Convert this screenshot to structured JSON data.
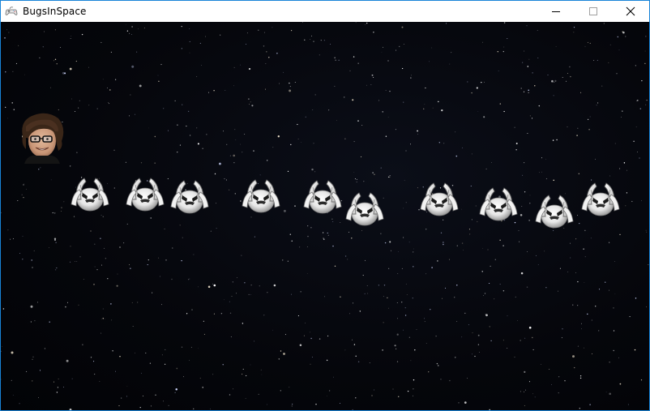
{
  "window": {
    "title": "BugsInSpace",
    "app_icon": "gamepad-icon",
    "controls": [
      "minimize-icon",
      "maximize-icon",
      "close-icon"
    ]
  },
  "game": {
    "background": "starfield",
    "player": {
      "sprite": "player-face-avatar"
    },
    "enemies": {
      "sprite": "bug-icon",
      "count": 10
    }
  }
}
